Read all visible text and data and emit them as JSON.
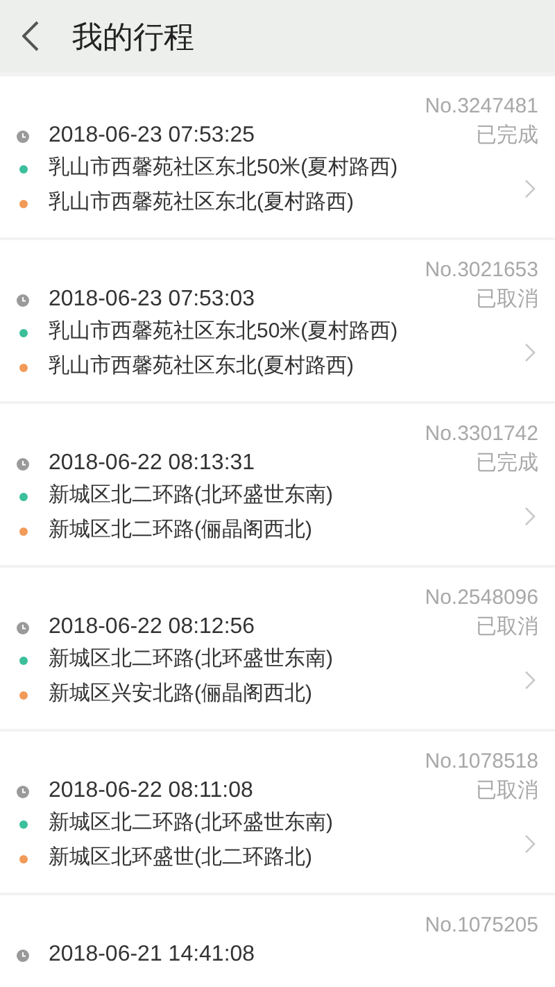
{
  "header": {
    "title": "我的行程"
  },
  "trips": [
    {
      "number": "No.3247481",
      "time": "2018-06-23 07:53:25",
      "status": "已完成",
      "stops": [
        {
          "kind": "origin",
          "text": "乳山市西馨苑社区东北50米(夏村路西)"
        },
        {
          "kind": "destination",
          "text": "乳山市西馨苑社区东北(夏村路西)"
        }
      ]
    },
    {
      "number": "No.3021653",
      "time": "2018-06-23 07:53:03",
      "status": "已取消",
      "stops": [
        {
          "kind": "origin",
          "text": "乳山市西馨苑社区东北50米(夏村路西)"
        },
        {
          "kind": "destination",
          "text": "乳山市西馨苑社区东北(夏村路西)"
        }
      ]
    },
    {
      "number": "No.3301742",
      "time": "2018-06-22 08:13:31",
      "status": "已完成",
      "stops": [
        {
          "kind": "origin",
          "text": "新城区北二环路(北环盛世东南)"
        },
        {
          "kind": "destination",
          "text": "新城区北二环路(俪晶阁西北)"
        }
      ]
    },
    {
      "number": "No.2548096",
      "time": "2018-06-22 08:12:56",
      "status": "已取消",
      "stops": [
        {
          "kind": "origin",
          "text": "新城区北二环路(北环盛世东南)"
        },
        {
          "kind": "destination",
          "text": "新城区兴安北路(俪晶阁西北)"
        }
      ]
    },
    {
      "number": "No.1078518",
      "time": "2018-06-22 08:11:08",
      "status": "已取消",
      "stops": [
        {
          "kind": "origin",
          "text": "新城区北二环路(北环盛世东南)"
        },
        {
          "kind": "destination",
          "text": "新城区北环盛世(北二环路北)"
        }
      ]
    },
    {
      "number": "No.1075205",
      "time": "2018-06-21 14:41:08"
    }
  ]
}
